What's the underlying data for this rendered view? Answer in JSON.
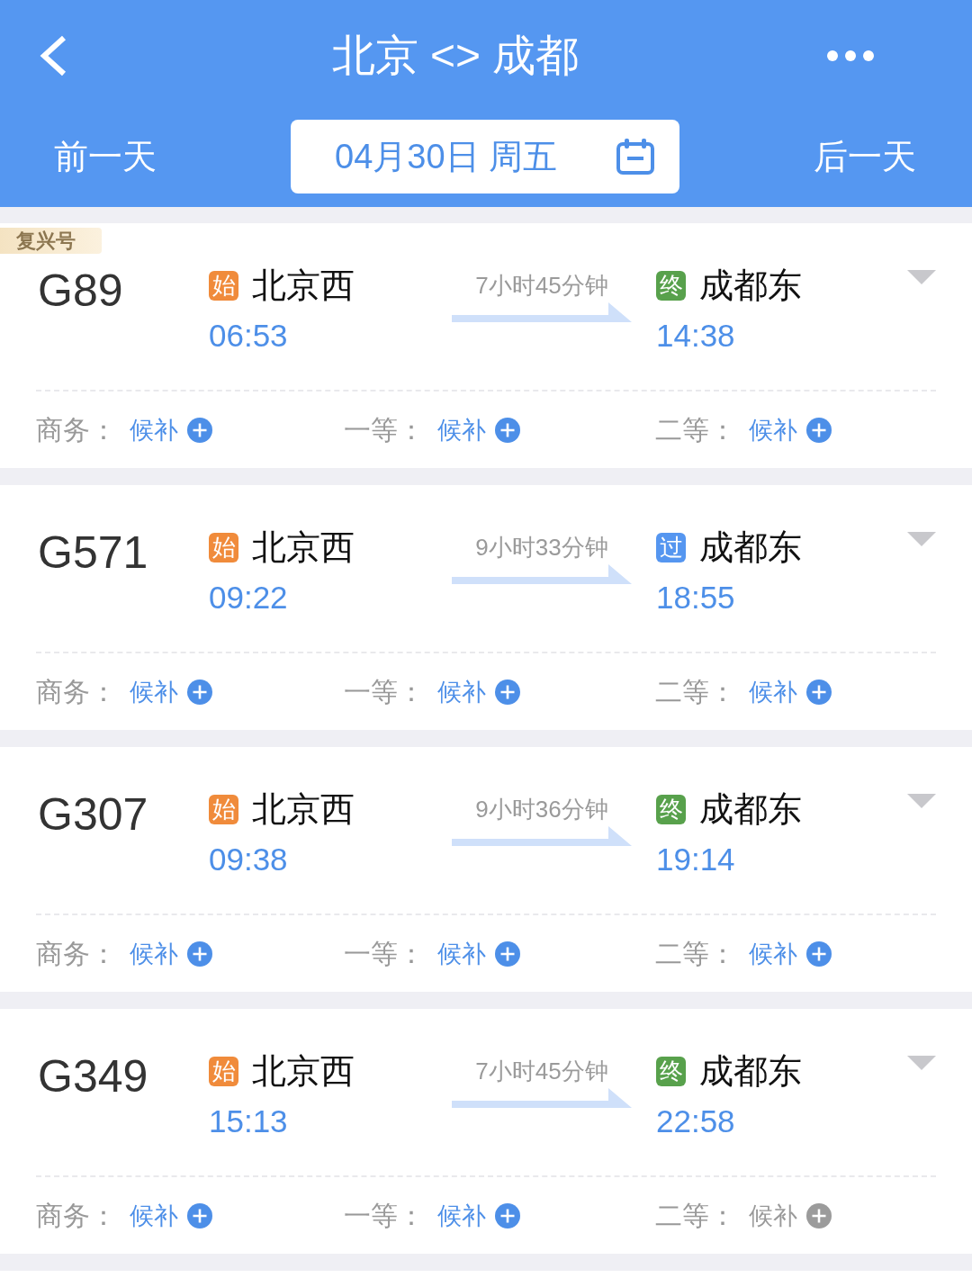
{
  "header": {
    "title": "北京 <> 成都",
    "prev_day": "前一天",
    "date": "04月30日 周五",
    "next_day": "后一天"
  },
  "trains": [
    {
      "tag": "复兴号",
      "number": "G89",
      "departure": {
        "badge": "始",
        "kind": "start",
        "station": "北京西",
        "time": "06:53"
      },
      "duration": "7小时45分钟",
      "arrival": {
        "badge": "终",
        "kind": "end",
        "station": "成都东",
        "time": "14:38"
      },
      "seats": [
        {
          "label": "商务：",
          "status": "候补",
          "disabled": false
        },
        {
          "label": "一等：",
          "status": "候补",
          "disabled": false
        },
        {
          "label": "二等：",
          "status": "候补",
          "disabled": false
        }
      ]
    },
    {
      "number": "G571",
      "departure": {
        "badge": "始",
        "kind": "start",
        "station": "北京西",
        "time": "09:22"
      },
      "duration": "9小时33分钟",
      "arrival": {
        "badge": "过",
        "kind": "pass",
        "station": "成都东",
        "time": "18:55"
      },
      "seats": [
        {
          "label": "商务：",
          "status": "候补",
          "disabled": false
        },
        {
          "label": "一等：",
          "status": "候补",
          "disabled": false
        },
        {
          "label": "二等：",
          "status": "候补",
          "disabled": false
        }
      ]
    },
    {
      "number": "G307",
      "departure": {
        "badge": "始",
        "kind": "start",
        "station": "北京西",
        "time": "09:38"
      },
      "duration": "9小时36分钟",
      "arrival": {
        "badge": "终",
        "kind": "end",
        "station": "成都东",
        "time": "19:14"
      },
      "seats": [
        {
          "label": "商务：",
          "status": "候补",
          "disabled": false
        },
        {
          "label": "一等：",
          "status": "候补",
          "disabled": false
        },
        {
          "label": "二等：",
          "status": "候补",
          "disabled": false
        }
      ]
    },
    {
      "number": "G349",
      "departure": {
        "badge": "始",
        "kind": "start",
        "station": "北京西",
        "time": "15:13"
      },
      "duration": "7小时45分钟",
      "arrival": {
        "badge": "终",
        "kind": "end",
        "station": "成都东",
        "time": "22:58"
      },
      "seats": [
        {
          "label": "商务：",
          "status": "候补",
          "disabled": false
        },
        {
          "label": "一等：",
          "status": "候补",
          "disabled": false
        },
        {
          "label": "二等：",
          "status": "候补",
          "disabled": true
        }
      ]
    }
  ]
}
